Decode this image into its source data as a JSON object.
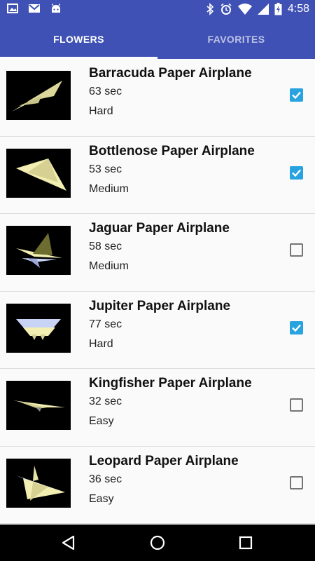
{
  "status_bar": {
    "time": "4:58",
    "left_icons": [
      "image-icon",
      "gmail-icon",
      "android-icon"
    ],
    "right_icons": [
      "bluetooth-icon",
      "alarm-icon",
      "wifi-icon",
      "cellular-icon",
      "battery-icon"
    ]
  },
  "tabs": [
    {
      "label": "FLOWERS",
      "active": true
    },
    {
      "label": "FAVORITES",
      "active": false
    }
  ],
  "items": [
    {
      "title": "Barracuda Paper Airplane",
      "time": "63 sec",
      "difficulty": "Hard",
      "favorite": true
    },
    {
      "title": "Bottlenose Paper Airplane",
      "time": "53 sec",
      "difficulty": "Medium",
      "favorite": true
    },
    {
      "title": "Jaguar Paper Airplane",
      "time": "58 sec",
      "difficulty": "Medium",
      "favorite": false
    },
    {
      "title": "Jupiter Paper Airplane",
      "time": "77 sec",
      "difficulty": "Hard",
      "favorite": true
    },
    {
      "title": "Kingfisher Paper Airplane",
      "time": "32 sec",
      "difficulty": "Easy",
      "favorite": false
    },
    {
      "title": "Leopard Paper Airplane",
      "time": "36 sec",
      "difficulty": "Easy",
      "favorite": false
    }
  ],
  "nav_bar": {
    "buttons": [
      "back-icon",
      "home-icon",
      "recents-icon"
    ]
  },
  "colors": {
    "primary": "#3f51b5",
    "checkbox": "#29a3e0",
    "paper": "#f3efb3",
    "paper_blue": "#c8d3f5"
  }
}
